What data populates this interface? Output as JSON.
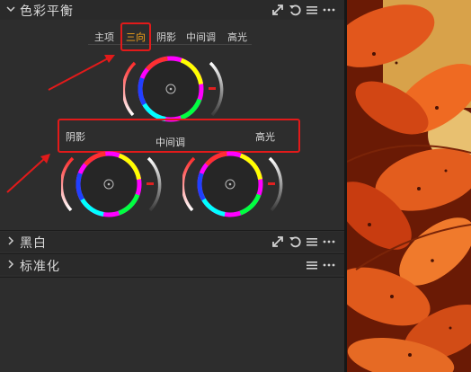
{
  "sections": {
    "color_balance": {
      "title": "色彩平衡",
      "expanded": true
    },
    "black_white": {
      "title": "黑白",
      "expanded": false
    },
    "standardize": {
      "title": "标准化",
      "expanded": false
    }
  },
  "tabs": [
    {
      "label": "主项",
      "active": false
    },
    {
      "label": "三向",
      "active": true
    },
    {
      "label": "阴影",
      "active": false
    },
    {
      "label": "中间调",
      "active": false
    },
    {
      "label": "高光",
      "active": false
    }
  ],
  "wheel_labels": {
    "shadows": "阴影",
    "midtones": "中间调",
    "highlights": "高光"
  },
  "colors": {
    "accent": "#f3a21a",
    "annotation_red": "#e21a1a",
    "panel_bg": "#2d2d2d"
  },
  "icons": {
    "collapse": "chevron-down-icon",
    "expand": "chevron-right-icon",
    "copy": "copy-arrow-icon",
    "reset": "reset-icon",
    "menu": "hamburger-menu-icon",
    "more": "more-dots-icon"
  }
}
